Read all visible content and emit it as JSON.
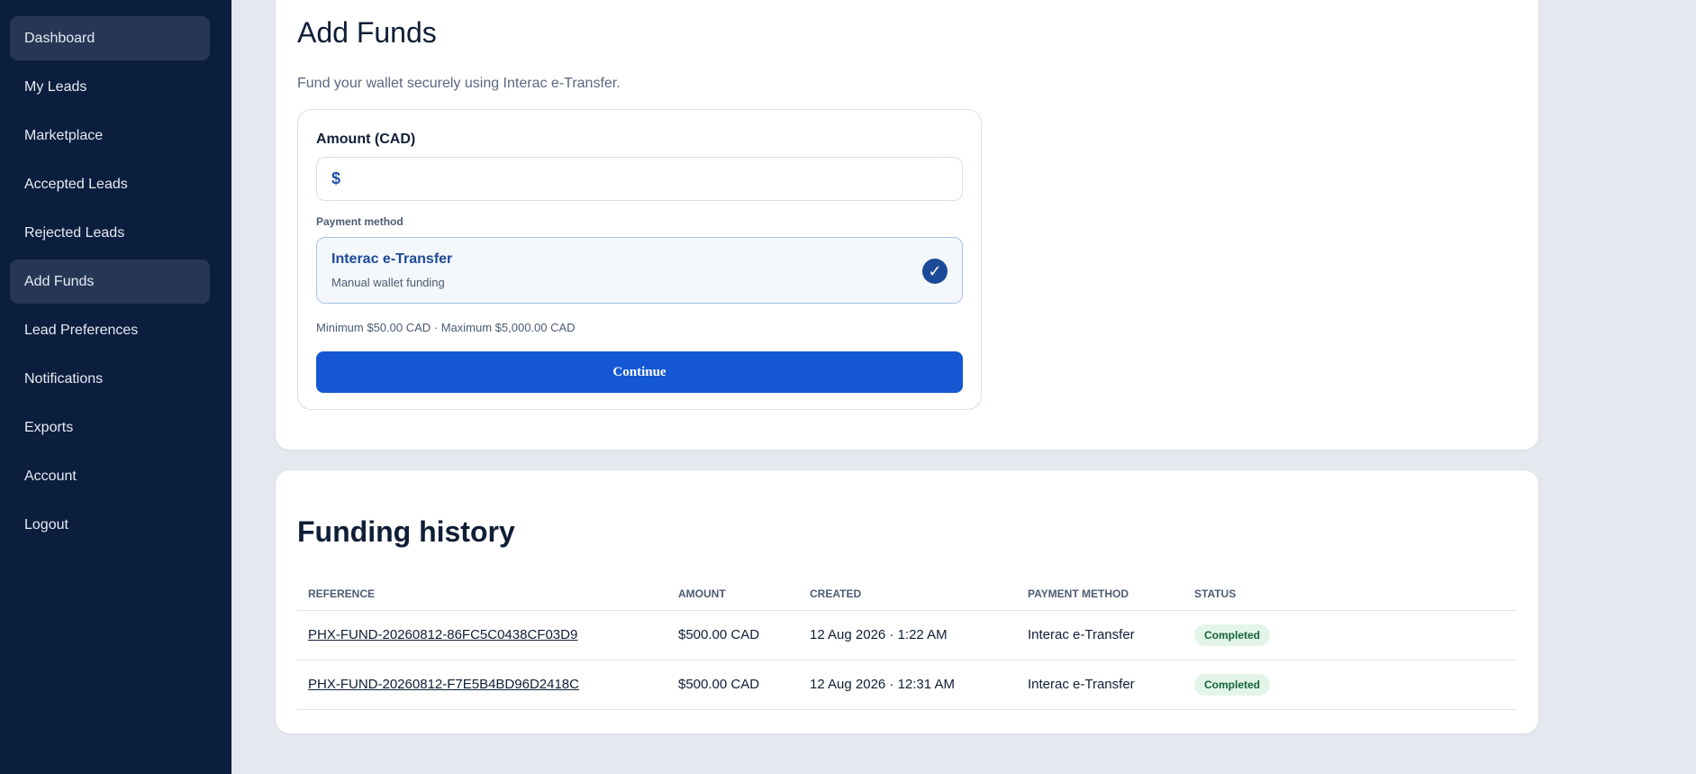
{
  "sidebar": {
    "items": [
      {
        "label": "Dashboard",
        "active": true
      },
      {
        "label": "My Leads",
        "active": false
      },
      {
        "label": "Marketplace",
        "active": false
      },
      {
        "label": "Accepted Leads",
        "active": false
      },
      {
        "label": "Rejected Leads",
        "active": false
      },
      {
        "label": "Add Funds",
        "active": true
      },
      {
        "label": "Lead Preferences",
        "active": false
      },
      {
        "label": "Notifications",
        "active": false
      },
      {
        "label": "Exports",
        "active": false
      },
      {
        "label": "Account",
        "active": false
      },
      {
        "label": "Logout",
        "active": false
      }
    ]
  },
  "add_funds": {
    "title": "Add Funds",
    "subtitle": "Fund your wallet securely using Interac e-Transfer.",
    "amount_label": "Amount (CAD)",
    "currency_symbol": "$",
    "amount_value": "",
    "payment_method_label": "Payment method",
    "payment_option": {
      "name": "Interac e-Transfer",
      "description": "Manual wallet funding",
      "selected": true,
      "check": "✓"
    },
    "limits": "Minimum $50.00 CAD · Maximum $5,000.00 CAD",
    "continue_label": "Continue"
  },
  "history": {
    "title": "Funding history",
    "columns": [
      "REFERENCE",
      "AMOUNT",
      "CREATED",
      "PAYMENT METHOD",
      "STATUS"
    ],
    "rows": [
      {
        "reference": "PHX-FUND-20260812-86FC5C0438CF03D9",
        "amount": "$500.00 CAD",
        "created": "12 Aug 2026 · 1:22 AM",
        "method": "Interac e-Transfer",
        "status": "Completed"
      },
      {
        "reference": "PHX-FUND-20260812-F7E5B4BD96D2418C",
        "amount": "$500.00 CAD",
        "created": "12 Aug 2026 · 12:31 AM",
        "method": "Interac e-Transfer",
        "status": "Completed"
      }
    ]
  },
  "colors": {
    "sidebar_bg": "#0c1e3d",
    "accent": "#1557d3",
    "success_bg": "#e3f5e9",
    "success_text": "#136436"
  }
}
